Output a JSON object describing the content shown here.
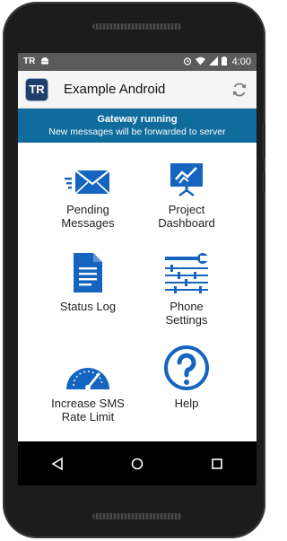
{
  "status_bar": {
    "left_icons": [
      "tr-app-icon",
      "android-icon"
    ],
    "right_icons": [
      "alarm-icon",
      "wifi-icon",
      "signal-icon",
      "battery-icon"
    ],
    "time": "4:00",
    "tr_glyph": "TR"
  },
  "app_bar": {
    "logo_text": "TR",
    "title": "Example Android",
    "refresh_icon": "refresh-icon"
  },
  "banner": {
    "title": "Gateway running",
    "subtitle": "New messages will be forwarded to server"
  },
  "menu": [
    {
      "label": "Pending\nMessages",
      "icon": "envelope-icon"
    },
    {
      "label": "Project\nDashboard",
      "icon": "dashboard-chart-icon"
    },
    {
      "label": "Status Log",
      "icon": "document-icon"
    },
    {
      "label": "Phone\nSettings",
      "icon": "settings-sliders-icon"
    },
    {
      "label": "Increase SMS\nRate Limit",
      "icon": "speedometer-icon"
    },
    {
      "label": "Help",
      "icon": "help-icon"
    }
  ],
  "nav_bar": {
    "buttons": [
      "back-icon",
      "home-icon",
      "recents-icon"
    ]
  },
  "colors": {
    "accent": "#1565c0",
    "banner": "#0f6c9c",
    "status_bar": "#5b5b5b"
  }
}
